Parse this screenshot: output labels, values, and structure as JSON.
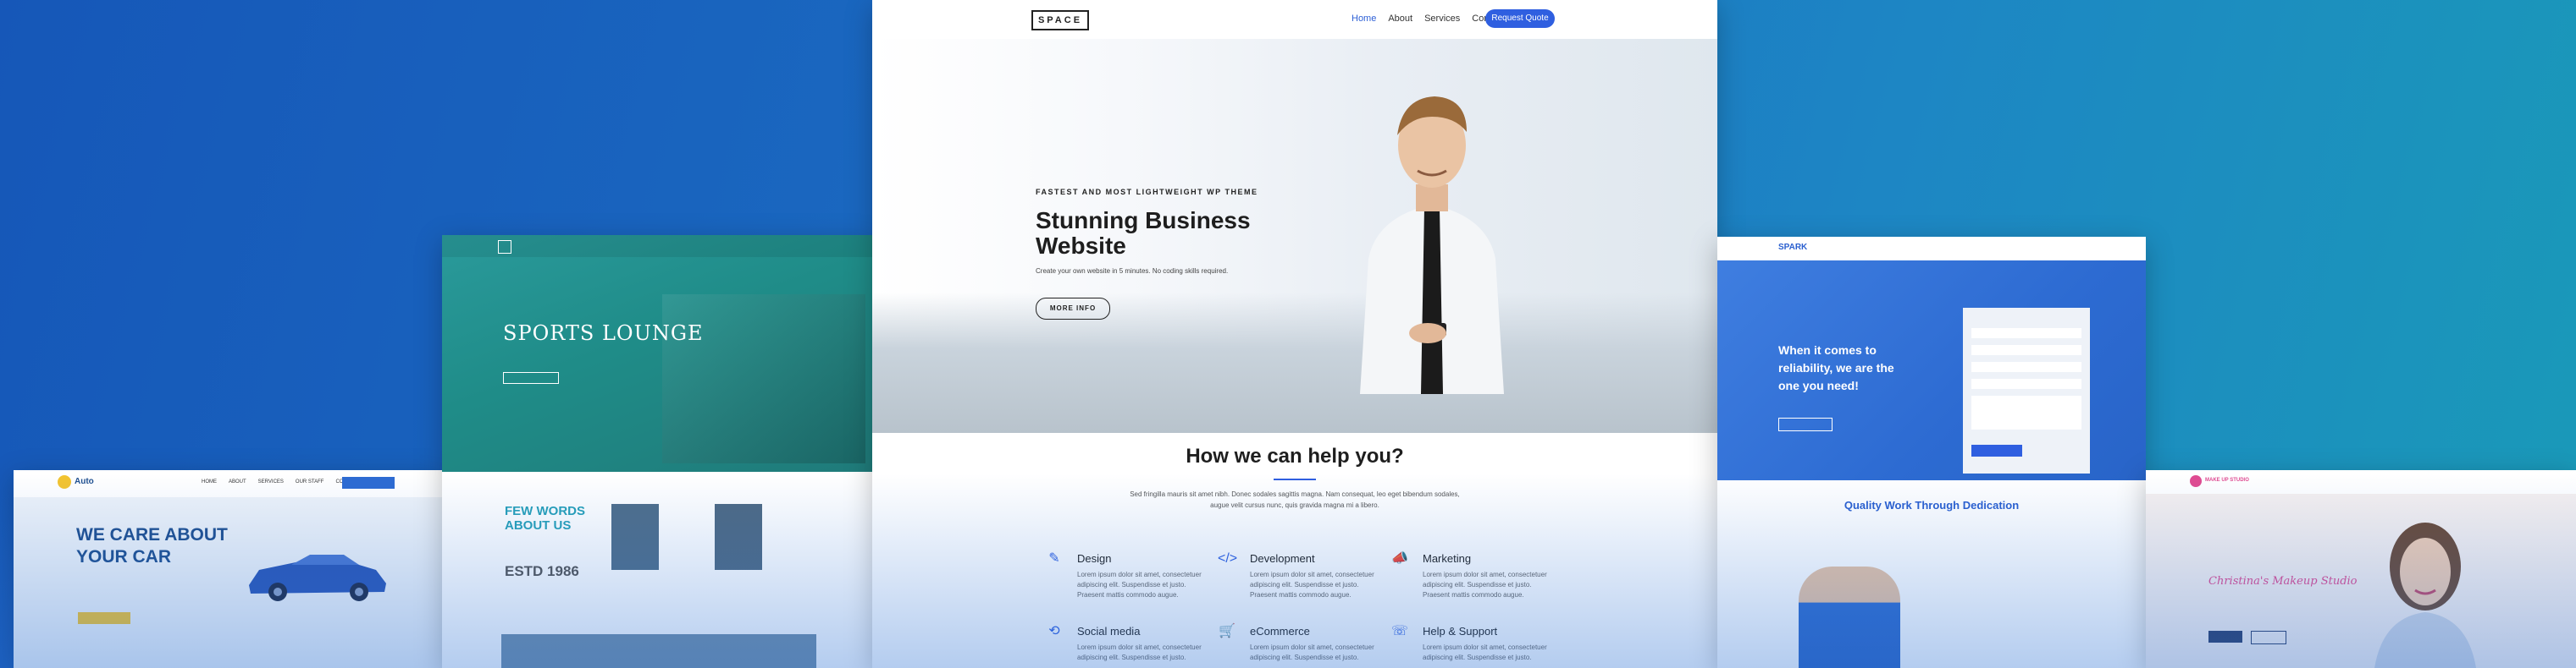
{
  "center": {
    "logo": "SPACE",
    "nav": [
      "Home",
      "About",
      "Services",
      "Contact"
    ],
    "quote_button": "Request Quote",
    "hero_tag": "FASTEST AND MOST LIGHTWEIGHT WP THEME",
    "hero_title": "Stunning Business Website",
    "hero_subtitle": "Create your own website in 5 minutes. No coding skills required.",
    "hero_button": "MORE INFO",
    "help_title": "How we can help you?",
    "help_desc": "Sed fringilla mauris sit amet nibh. Donec sodales sagittis magna. Nam consequat, leo eget bibendum sodales, augue velit cursus nunc, quis gravida magna mi a libero.",
    "features": [
      {
        "title": "Design",
        "icon": "pen-icon",
        "desc": "Lorem ipsum dolor sit amet, consectetuer adipiscing elit. Suspendisse et justo. Praesent mattis commodo augue."
      },
      {
        "title": "Development",
        "icon": "code-icon",
        "desc": "Lorem ipsum dolor sit amet, consectetuer adipiscing elit. Suspendisse et justo. Praesent mattis commodo augue."
      },
      {
        "title": "Marketing",
        "icon": "megaphone-icon",
        "desc": "Lorem ipsum dolor sit amet, consectetuer adipiscing elit. Suspendisse et justo. Praesent mattis commodo augue."
      },
      {
        "title": "Social media",
        "icon": "share-icon",
        "desc": "Lorem ipsum dolor sit amet, consectetuer adipiscing elit. Suspendisse et justo."
      },
      {
        "title": "eCommerce",
        "icon": "cart-icon",
        "desc": "Lorem ipsum dolor sit amet, consectetuer adipiscing elit. Suspendisse et justo."
      },
      {
        "title": "Help & Support",
        "icon": "support-icon",
        "desc": "Lorem ipsum dolor sit amet, consectetuer adipiscing elit. Suspendisse et justo."
      }
    ]
  },
  "sports": {
    "title": "SPORTS LOUNGE",
    "few_words": "FEW WORDS ABOUT US",
    "estd": "ESTD 1986"
  },
  "auto": {
    "brand": "Auto",
    "headline": "WE CARE ABOUT YOUR CAR",
    "nav": [
      "HOME",
      "ABOUT",
      "SERVICES",
      "OUR STAFF",
      "CONTACT"
    ]
  },
  "spark": {
    "logo": "SPARK",
    "headline": "When it comes to reliability, we are the one you need!",
    "quality": "Quality Work Through Dedication"
  },
  "makeup": {
    "brand": "MAKE UP STUDIO",
    "script_title": "Christina's Makeup Studio"
  },
  "colors": {
    "background": "#1a68c0",
    "accent": "#2f5fe0",
    "sports_teal": "#1f8c88",
    "spark_blue": "#2d6bd2",
    "makeup_pink": "#e04b91"
  }
}
